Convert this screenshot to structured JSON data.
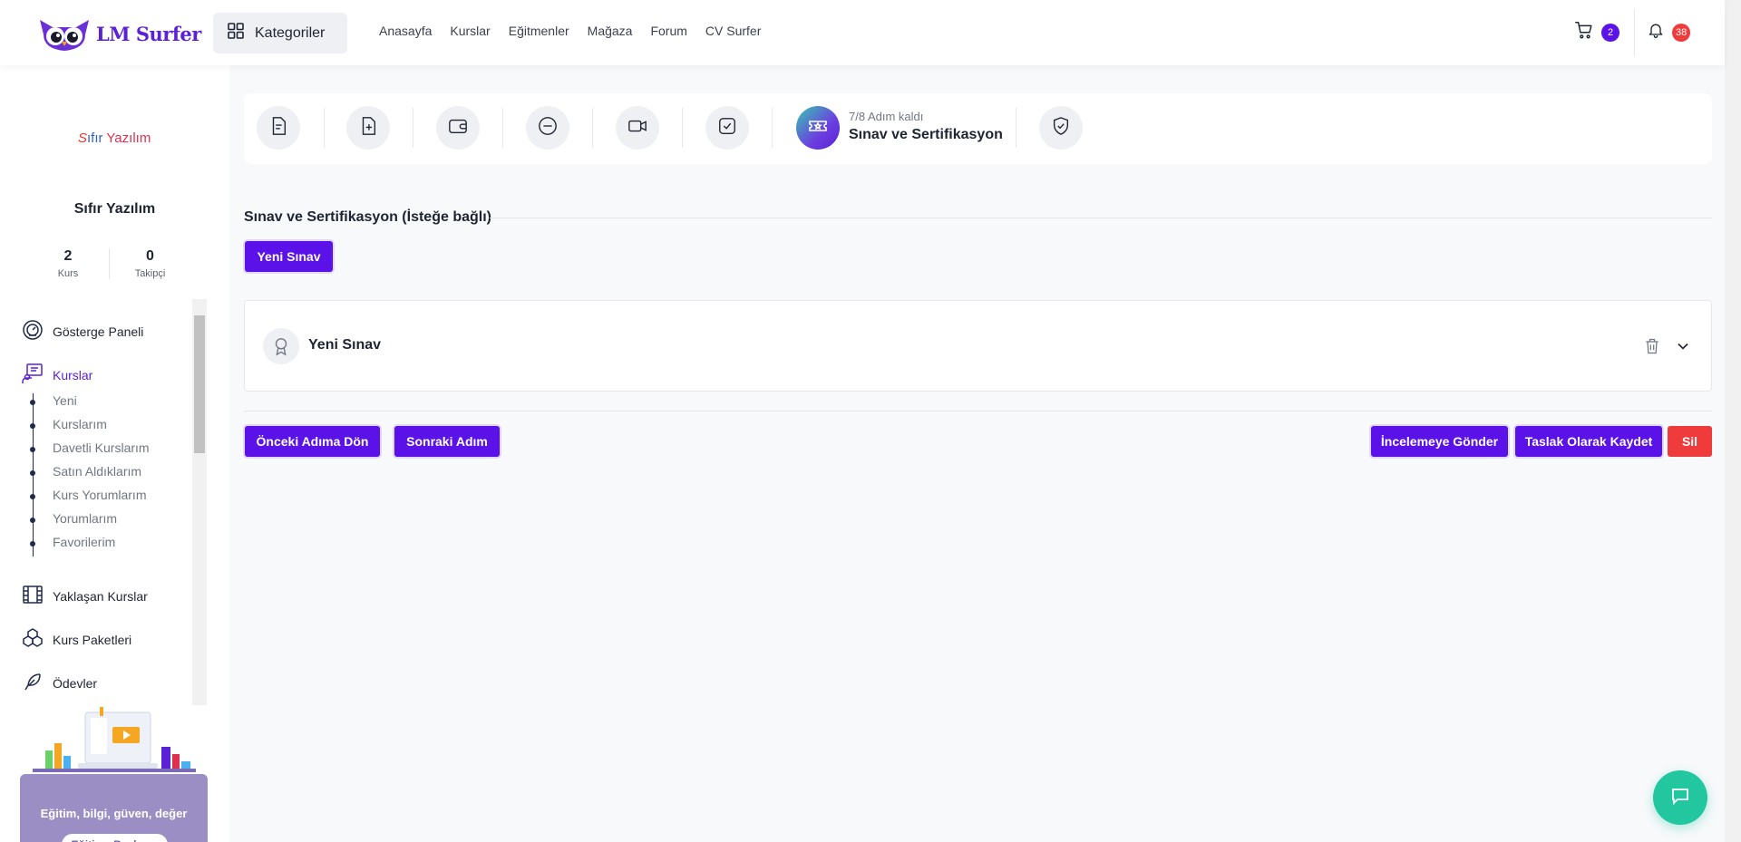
{
  "header": {
    "logo_text": "LM Surfer",
    "categories_label": "Kategoriler",
    "nav": [
      "Anasayfa",
      "Kurslar",
      "Eğitmenler",
      "Mağaza",
      "Forum",
      "CV Surfer"
    ],
    "cart_count": "2",
    "notification_count": "38"
  },
  "sidebar": {
    "brand_logo": {
      "part1": "S",
      "part2": "ıfır",
      "part3": " Yazılım"
    },
    "profile_name": "Sıfır Yazılım",
    "stats": [
      {
        "value": "2",
        "label": "Kurs"
      },
      {
        "value": "0",
        "label": "Takipçi"
      }
    ],
    "menu": {
      "dashboard": "Gösterge Paneli",
      "courses": "Kurslar",
      "course_sub": [
        "Yeni",
        "Kurslarım",
        "Davetli Kurslarım",
        "Satın Aldıklarım",
        "Kurs Yorumlarım",
        "Yorumlarım",
        "Favorilerim"
      ],
      "upcoming": "Yaklaşan Kurslar",
      "bundles": "Kurs Paketleri",
      "assignments": "Ödevler"
    },
    "promo": {
      "text": "Eğitim, bilgi, güven, değer",
      "button": "Eğitime Başlayın"
    }
  },
  "steps": {
    "remaining": "7/8 Adım kaldı",
    "current": "Sınav ve Sertifikasyon",
    "icons": [
      "document-icon",
      "file-plus-icon",
      "wallet-icon",
      "folder-minus-icon",
      "video-icon",
      "checkbox-icon",
      "ticket-star-icon",
      "shield-check-icon"
    ]
  },
  "main": {
    "section_title": "Sınav ve Sertifikasyon (İsteğe bağlı)",
    "new_exam_button": "Yeni Sınav",
    "exam_title": "Yeni Sınav",
    "buttons": {
      "previous": "Önceki Adıma Dön",
      "next": "Sonraki Adım",
      "submit_review": "İncelemeye Gönder",
      "save_draft": "Taslak Olarak Kaydet",
      "delete": "Sil"
    }
  },
  "colors": {
    "primary": "#5b12e8",
    "danger": "#ef3b3b",
    "accent_green": "#22c7a0"
  }
}
